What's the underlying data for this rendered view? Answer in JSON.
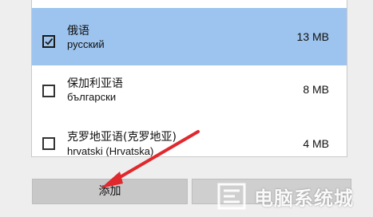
{
  "languages": [
    {
      "name": "俄语",
      "native": "русский",
      "size": "13 MB",
      "checked": true
    },
    {
      "name": "保加利亚语",
      "native": "български",
      "size": "8 MB",
      "checked": false
    },
    {
      "name": "克罗地亚语(克罗地亚)",
      "native": "hrvatski (Hrvatska)",
      "size": "4 MB",
      "checked": false
    }
  ],
  "buttons": {
    "add_label": "添加",
    "cancel_label": ""
  },
  "watermark": {
    "text": "电脑系统城"
  },
  "colors": {
    "selected_row": "#9dc4ee",
    "arrow": "#e0282d"
  }
}
